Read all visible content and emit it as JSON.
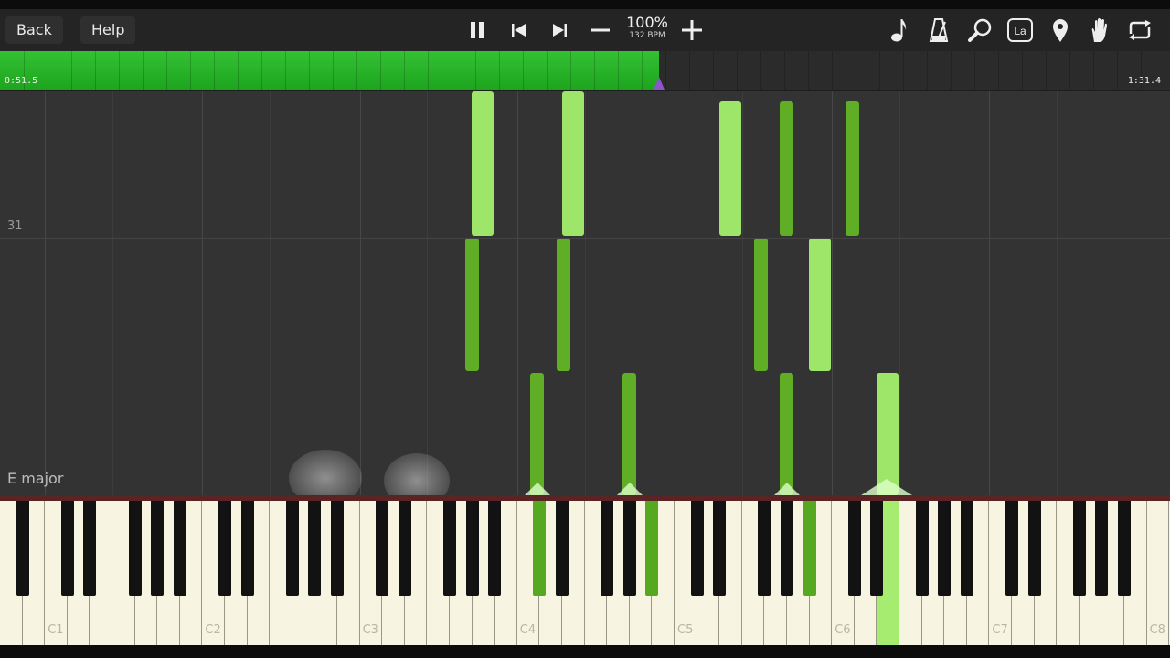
{
  "toolbar": {
    "back_label": "Back",
    "help_label": "Help",
    "speed_percent": "100%",
    "tempo": "132 BPM",
    "controls": [
      "pause-icon",
      "previous-icon",
      "next-icon",
      "minus-icon",
      "plus-icon"
    ],
    "right_icons": [
      "note-icon",
      "metronome-icon",
      "magnifier-icon",
      "la-label-icon",
      "location-pin-icon",
      "hand-icon",
      "loop-icon"
    ],
    "la_text": "La"
  },
  "progress": {
    "elapsed": "0:51.5",
    "total": "1:31.4",
    "fraction": 0.563,
    "color": "#22b022"
  },
  "roll": {
    "measure_number": "31",
    "key_signature": "E major",
    "note_colors": {
      "light": "#9ee66a",
      "dark": "#5fae26"
    }
  },
  "keyboard": {
    "octave_labels": [
      "C1",
      "C2",
      "C3",
      "C4",
      "C5",
      "C6",
      "C7",
      "C8"
    ],
    "pressed_color": "#a6ec70"
  }
}
